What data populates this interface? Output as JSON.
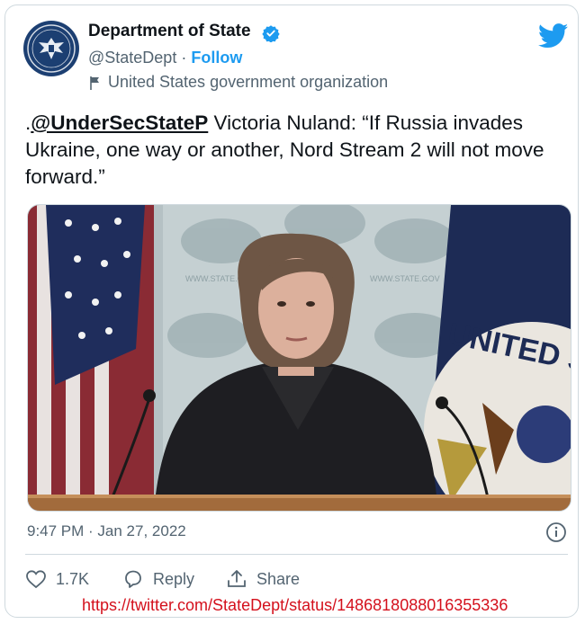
{
  "account": {
    "name": "Department of State",
    "handle": "@StateDept",
    "separator": "·",
    "follow_label": "Follow",
    "org_label": "United States government organization"
  },
  "tweet": {
    "prefix": ".",
    "mention": "@UnderSecStateP",
    "body": " Victoria Nuland: “If Russia invades Ukraine, one way or another, Nord Stream 2 will not move forward.”"
  },
  "media": {
    "podium_seal_text": "UNITED STA",
    "backdrop_text": "WWW.STATE.GOV"
  },
  "meta": {
    "timestamp": "9:47 PM · Jan 27, 2022"
  },
  "actions": {
    "like_count": "1.7K",
    "reply_label": "Reply",
    "share_label": "Share"
  },
  "footer": {
    "url": "https://twitter.com/StateDept/status/1486818088016355336"
  },
  "colors": {
    "twitter_blue": "#1d9bf0",
    "secondary_text": "#536471",
    "url_red": "#d4101c"
  }
}
